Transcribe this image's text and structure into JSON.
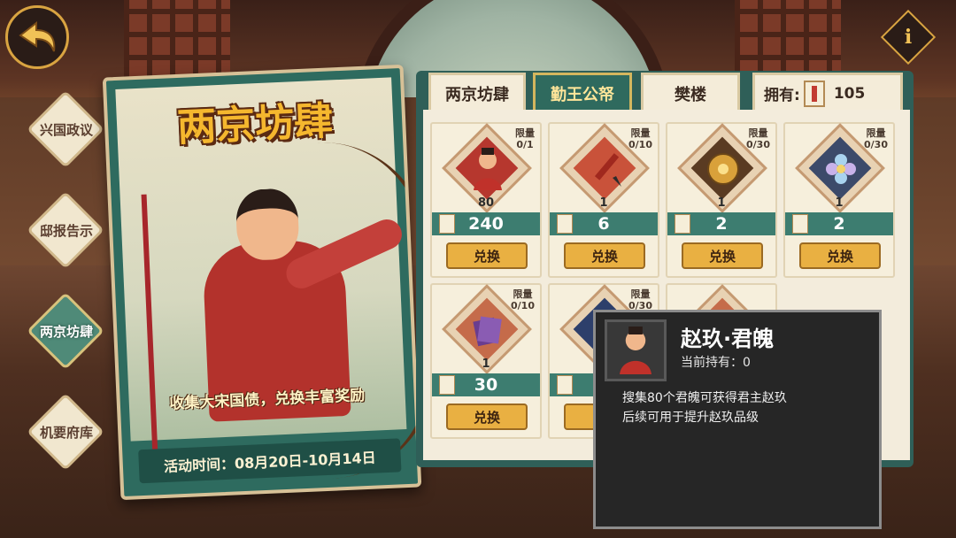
{
  "nav": {
    "items": [
      {
        "label": "兴国政议"
      },
      {
        "label": "邸报告示"
      },
      {
        "label": "两京坊肆"
      },
      {
        "label": "机要府库"
      }
    ]
  },
  "banner": {
    "title": "两京坊肆",
    "slogan": "收集大宋国债，兑换丰富奖励",
    "time": "活动时间：08月20日-10月14日"
  },
  "tabs": [
    {
      "label": "两京坊肆"
    },
    {
      "label": "勤王公帑"
    },
    {
      "label": "樊楼"
    }
  ],
  "currency": {
    "label": "拥有:",
    "amount": "105"
  },
  "items": [
    {
      "limit_label": "限量",
      "limit": "0/1",
      "qty": "80",
      "price": "240",
      "button": "兑换",
      "icon": "character-portrait-icon"
    },
    {
      "limit_label": "限量",
      "limit": "0/10",
      "qty": "1",
      "price": "6",
      "button": "兑换",
      "icon": "brush-icon"
    },
    {
      "limit_label": "限量",
      "limit": "0/30",
      "qty": "1",
      "price": "2",
      "button": "兑换",
      "icon": "gold-medallion-icon"
    },
    {
      "limit_label": "限量",
      "limit": "0/30",
      "qty": "1",
      "price": "2",
      "button": "兑换",
      "icon": "crystal-flower-icon"
    },
    {
      "limit_label": "限量",
      "limit": "0/10",
      "qty": "1",
      "price": "30",
      "button": "兑换",
      "icon": "book-icon"
    },
    {
      "limit_label": "限量",
      "limit": "0/30"
    }
  ],
  "tooltip": {
    "name": "赵玖·君魄",
    "owned": "当前持有：0",
    "desc_line1": "搜集80个君魄可获得君主赵玖",
    "desc_line2": "后续可用于提升赵玖品级"
  },
  "colors": {
    "accent": "#2f6a5e",
    "gold_button": "#e9b042",
    "title_gold": "#f5b72e"
  }
}
